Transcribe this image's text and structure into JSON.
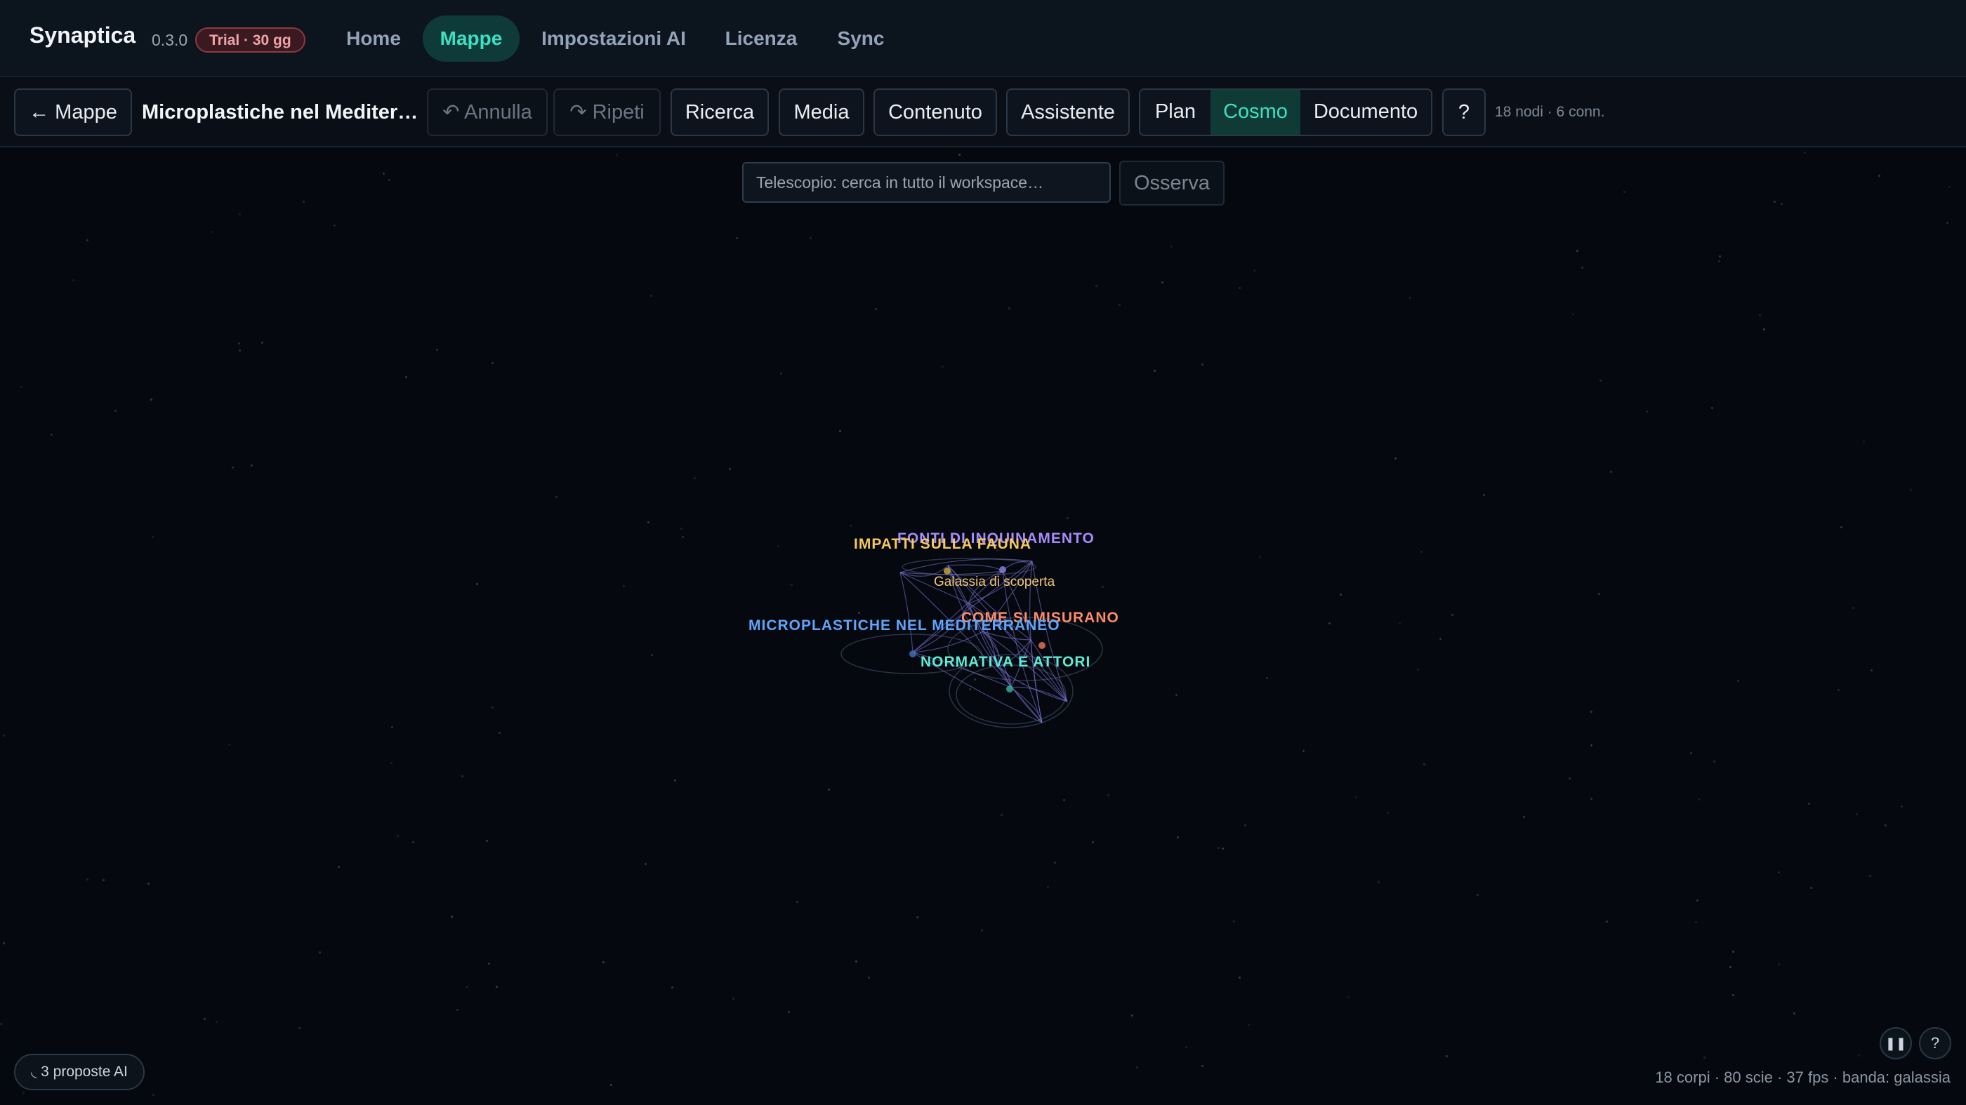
{
  "app": {
    "name": "Synaptica",
    "version": "0.3.0",
    "trial_badge": "Trial · 30 gg"
  },
  "nav": {
    "items": [
      {
        "label": "Home",
        "active": false
      },
      {
        "label": "Mappe",
        "active": true
      },
      {
        "label": "Impostazioni AI",
        "active": false
      },
      {
        "label": "Licenza",
        "active": false
      },
      {
        "label": "Sync",
        "active": false
      }
    ]
  },
  "toolbar": {
    "back_label": "← Mappe",
    "map_title": "Microplastiche nel Mediter…",
    "undo_label": "↶ Annulla",
    "redo_label": "↷ Ripeti",
    "research_label": "Ricerca",
    "media_label": "Media",
    "content_label": "Contenuto",
    "assistant_label": "Assistente",
    "views": [
      {
        "label": "Plan",
        "active": false
      },
      {
        "label": "Cosmo",
        "active": true
      },
      {
        "label": "Documento",
        "active": false
      }
    ],
    "help_label": "?",
    "stats": "18 nodi · 6 conn."
  },
  "telescope": {
    "placeholder": "Telescopio: cerca in tutto il workspace…",
    "button_label": "Osserva"
  },
  "cosmos": {
    "galaxies": [
      {
        "label": "IMPATTI SULLA FAUNA",
        "color": "#f5c95c"
      },
      {
        "label": "FONTI DI INQUINAMENTO",
        "color": "#a78bfa"
      },
      {
        "label": "COME SI MISURANO",
        "color": "#fb8c6a"
      },
      {
        "label": "MICROPLASTICHE NEL MEDITERRANEO",
        "color": "#60a5fa"
      },
      {
        "label": "NORMATIVA E ATTORI",
        "color": "#5eead4"
      }
    ],
    "discovery_label": "Galassia di scoperta"
  },
  "footer": {
    "proposals_label": "3 proposte AI",
    "pause_label": "❚❚",
    "help_label": "?",
    "stats": "18 corpi · 80 scie · 37 fps · banda: galassia"
  }
}
